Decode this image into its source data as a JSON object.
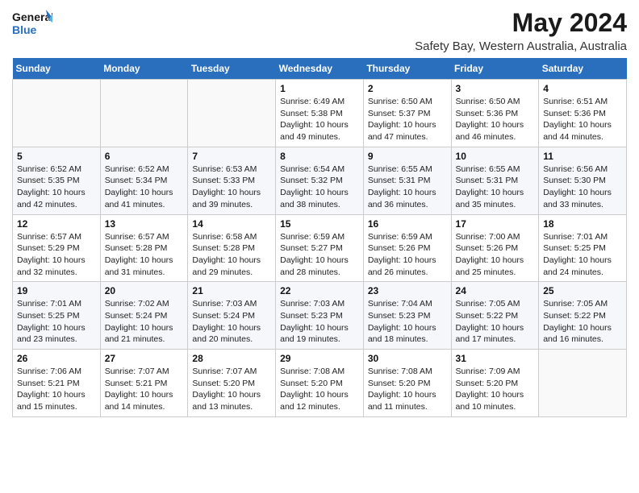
{
  "logo": {
    "line1": "General",
    "line2": "Blue"
  },
  "title": "May 2024",
  "subtitle": "Safety Bay, Western Australia, Australia",
  "headers": [
    "Sunday",
    "Monday",
    "Tuesday",
    "Wednesday",
    "Thursday",
    "Friday",
    "Saturday"
  ],
  "weeks": [
    [
      {
        "day": "",
        "info": ""
      },
      {
        "day": "",
        "info": ""
      },
      {
        "day": "",
        "info": ""
      },
      {
        "day": "1",
        "info": "Sunrise: 6:49 AM\nSunset: 5:38 PM\nDaylight: 10 hours\nand 49 minutes."
      },
      {
        "day": "2",
        "info": "Sunrise: 6:50 AM\nSunset: 5:37 PM\nDaylight: 10 hours\nand 47 minutes."
      },
      {
        "day": "3",
        "info": "Sunrise: 6:50 AM\nSunset: 5:36 PM\nDaylight: 10 hours\nand 46 minutes."
      },
      {
        "day": "4",
        "info": "Sunrise: 6:51 AM\nSunset: 5:36 PM\nDaylight: 10 hours\nand 44 minutes."
      }
    ],
    [
      {
        "day": "5",
        "info": "Sunrise: 6:52 AM\nSunset: 5:35 PM\nDaylight: 10 hours\nand 42 minutes."
      },
      {
        "day": "6",
        "info": "Sunrise: 6:52 AM\nSunset: 5:34 PM\nDaylight: 10 hours\nand 41 minutes."
      },
      {
        "day": "7",
        "info": "Sunrise: 6:53 AM\nSunset: 5:33 PM\nDaylight: 10 hours\nand 39 minutes."
      },
      {
        "day": "8",
        "info": "Sunrise: 6:54 AM\nSunset: 5:32 PM\nDaylight: 10 hours\nand 38 minutes."
      },
      {
        "day": "9",
        "info": "Sunrise: 6:55 AM\nSunset: 5:31 PM\nDaylight: 10 hours\nand 36 minutes."
      },
      {
        "day": "10",
        "info": "Sunrise: 6:55 AM\nSunset: 5:31 PM\nDaylight: 10 hours\nand 35 minutes."
      },
      {
        "day": "11",
        "info": "Sunrise: 6:56 AM\nSunset: 5:30 PM\nDaylight: 10 hours\nand 33 minutes."
      }
    ],
    [
      {
        "day": "12",
        "info": "Sunrise: 6:57 AM\nSunset: 5:29 PM\nDaylight: 10 hours\nand 32 minutes."
      },
      {
        "day": "13",
        "info": "Sunrise: 6:57 AM\nSunset: 5:28 PM\nDaylight: 10 hours\nand 31 minutes."
      },
      {
        "day": "14",
        "info": "Sunrise: 6:58 AM\nSunset: 5:28 PM\nDaylight: 10 hours\nand 29 minutes."
      },
      {
        "day": "15",
        "info": "Sunrise: 6:59 AM\nSunset: 5:27 PM\nDaylight: 10 hours\nand 28 minutes."
      },
      {
        "day": "16",
        "info": "Sunrise: 6:59 AM\nSunset: 5:26 PM\nDaylight: 10 hours\nand 26 minutes."
      },
      {
        "day": "17",
        "info": "Sunrise: 7:00 AM\nSunset: 5:26 PM\nDaylight: 10 hours\nand 25 minutes."
      },
      {
        "day": "18",
        "info": "Sunrise: 7:01 AM\nSunset: 5:25 PM\nDaylight: 10 hours\nand 24 minutes."
      }
    ],
    [
      {
        "day": "19",
        "info": "Sunrise: 7:01 AM\nSunset: 5:25 PM\nDaylight: 10 hours\nand 23 minutes."
      },
      {
        "day": "20",
        "info": "Sunrise: 7:02 AM\nSunset: 5:24 PM\nDaylight: 10 hours\nand 21 minutes."
      },
      {
        "day": "21",
        "info": "Sunrise: 7:03 AM\nSunset: 5:24 PM\nDaylight: 10 hours\nand 20 minutes."
      },
      {
        "day": "22",
        "info": "Sunrise: 7:03 AM\nSunset: 5:23 PM\nDaylight: 10 hours\nand 19 minutes."
      },
      {
        "day": "23",
        "info": "Sunrise: 7:04 AM\nSunset: 5:23 PM\nDaylight: 10 hours\nand 18 minutes."
      },
      {
        "day": "24",
        "info": "Sunrise: 7:05 AM\nSunset: 5:22 PM\nDaylight: 10 hours\nand 17 minutes."
      },
      {
        "day": "25",
        "info": "Sunrise: 7:05 AM\nSunset: 5:22 PM\nDaylight: 10 hours\nand 16 minutes."
      }
    ],
    [
      {
        "day": "26",
        "info": "Sunrise: 7:06 AM\nSunset: 5:21 PM\nDaylight: 10 hours\nand 15 minutes."
      },
      {
        "day": "27",
        "info": "Sunrise: 7:07 AM\nSunset: 5:21 PM\nDaylight: 10 hours\nand 14 minutes."
      },
      {
        "day": "28",
        "info": "Sunrise: 7:07 AM\nSunset: 5:20 PM\nDaylight: 10 hours\nand 13 minutes."
      },
      {
        "day": "29",
        "info": "Sunrise: 7:08 AM\nSunset: 5:20 PM\nDaylight: 10 hours\nand 12 minutes."
      },
      {
        "day": "30",
        "info": "Sunrise: 7:08 AM\nSunset: 5:20 PM\nDaylight: 10 hours\nand 11 minutes."
      },
      {
        "day": "31",
        "info": "Sunrise: 7:09 AM\nSunset: 5:20 PM\nDaylight: 10 hours\nand 10 minutes."
      },
      {
        "day": "",
        "info": ""
      }
    ]
  ]
}
